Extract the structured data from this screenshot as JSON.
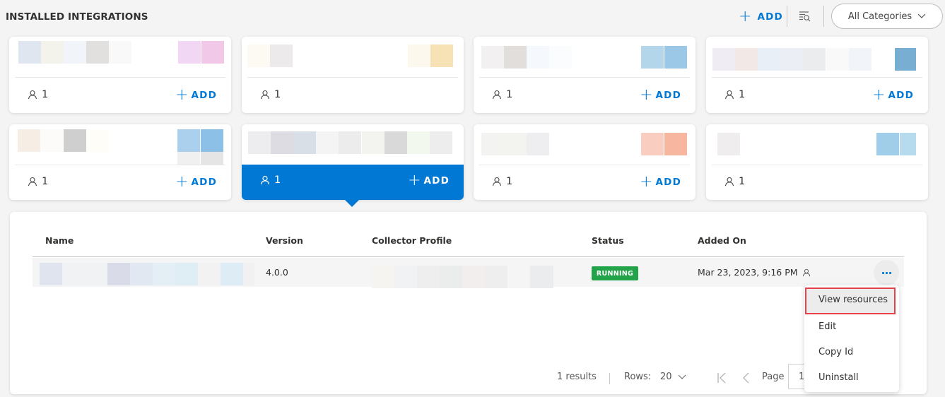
{
  "header": {
    "title": "INSTALLED INTEGRATIONS",
    "add_label": "ADD",
    "filter_icon": "filter-search-icon",
    "category_select": {
      "selected": "All Categories"
    }
  },
  "colors": {
    "accent": "#0078d4",
    "status_running": "#22a34a",
    "highlight_outline": "#e8414a"
  },
  "cards": [
    {
      "users": "1",
      "add_label": "ADD",
      "has_add": true,
      "selected": false
    },
    {
      "users": "1",
      "add_label": "",
      "has_add": false,
      "selected": false
    },
    {
      "users": "1",
      "add_label": "ADD",
      "has_add": true,
      "selected": false
    },
    {
      "users": "1",
      "add_label": "ADD",
      "has_add": true,
      "selected": false
    },
    {
      "users": "1",
      "add_label": "ADD",
      "has_add": true,
      "selected": false
    },
    {
      "users": "1",
      "add_label": "ADD",
      "has_add": true,
      "selected": true
    },
    {
      "users": "1",
      "add_label": "ADD",
      "has_add": true,
      "selected": false
    },
    {
      "users": "1",
      "add_label": "",
      "has_add": false,
      "selected": false
    }
  ],
  "table": {
    "columns": [
      "Name",
      "Version",
      "Collector Profile",
      "Status",
      "Added On"
    ],
    "rows": [
      {
        "name": "",
        "version": "4.0.0",
        "collector_profile": "",
        "status": "RUNNING",
        "added_on": "Mar 23, 2023, 9:16 PM"
      }
    ]
  },
  "row_menu": {
    "items": [
      "View resources",
      "Edit",
      "Copy Id",
      "Uninstall"
    ],
    "highlighted": "View resources"
  },
  "pagination": {
    "results": "1 results",
    "rows_label": "Rows:",
    "rows_value": "20",
    "page_label": "Page",
    "page_value": "1"
  }
}
